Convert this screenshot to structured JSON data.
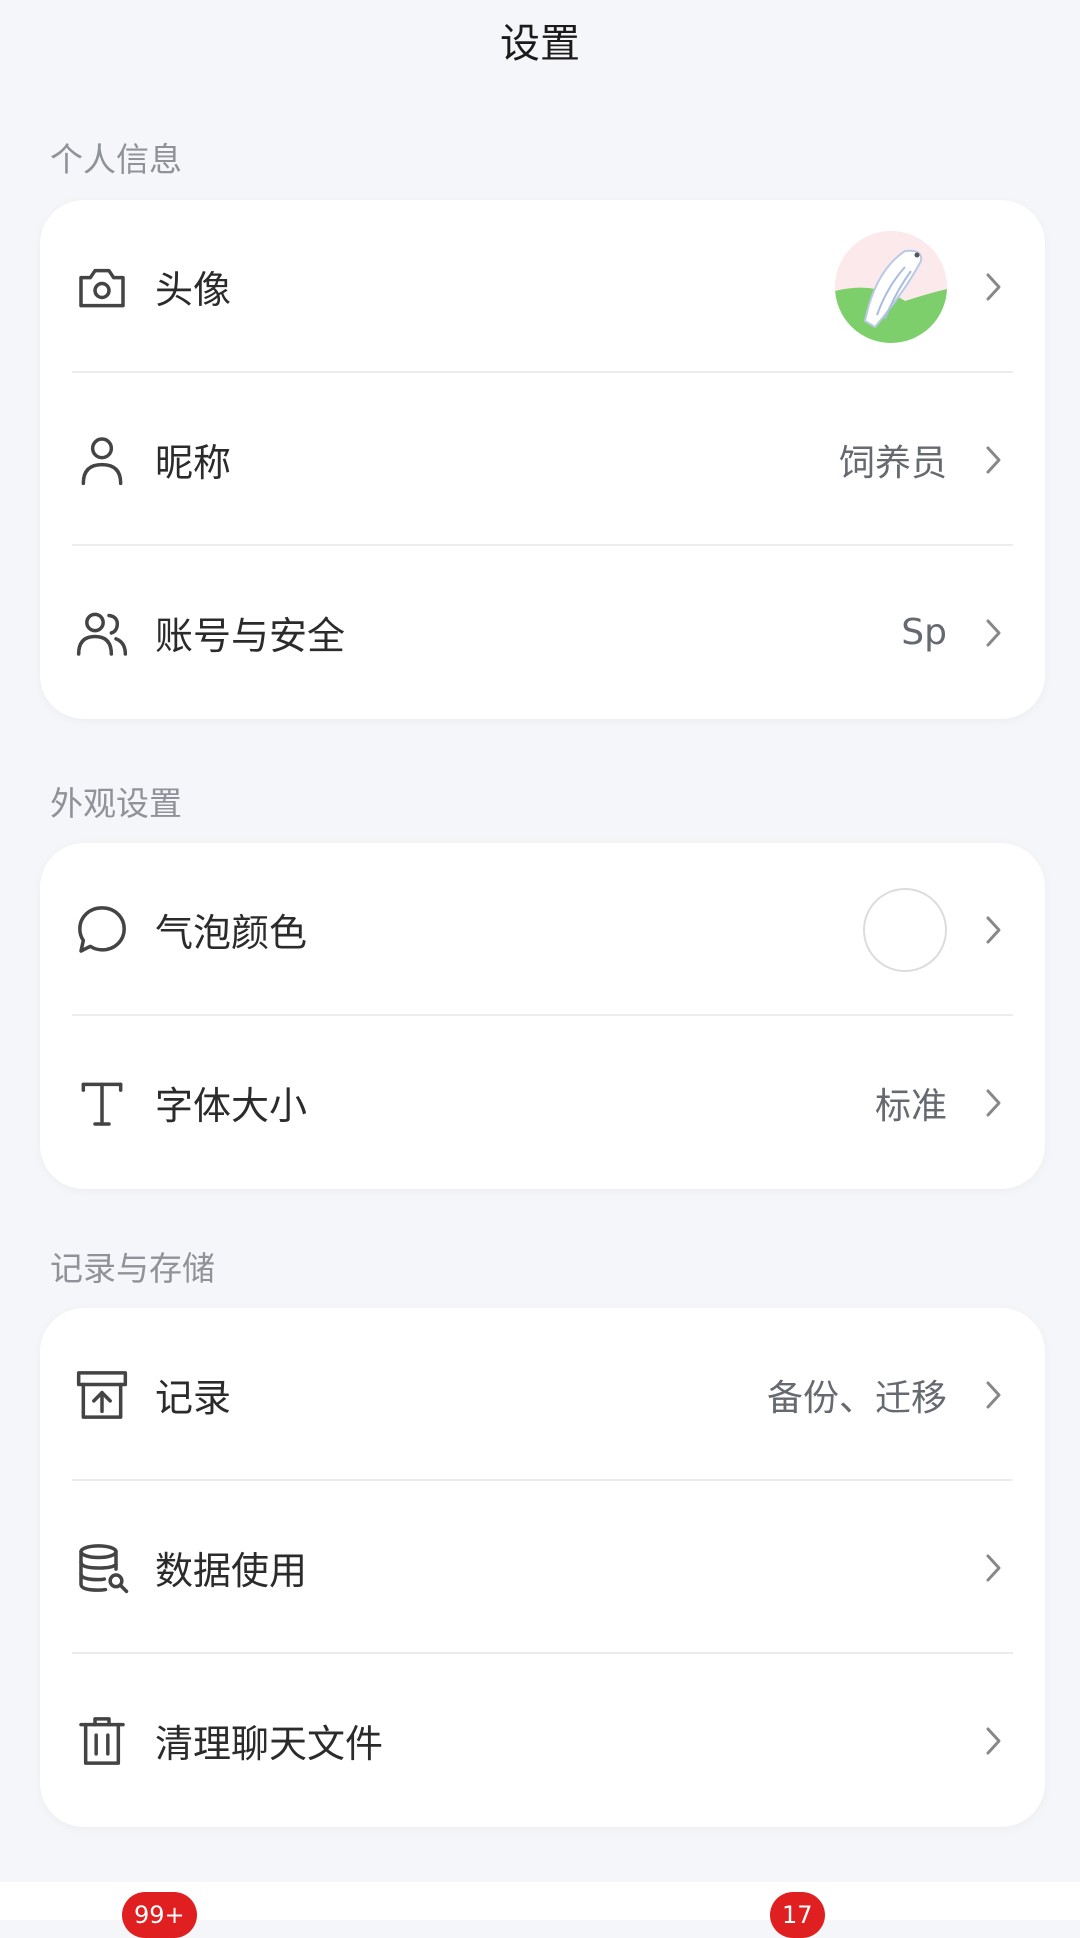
{
  "header": {
    "title": "设置"
  },
  "sections": [
    {
      "label": "个人信息",
      "items": [
        {
          "icon": "camera-icon",
          "label": "头像",
          "value": "",
          "trailing": "avatar"
        },
        {
          "icon": "user-icon",
          "label": "昵称",
          "value": "饲养员"
        },
        {
          "icon": "users-icon",
          "label": "账号与安全",
          "value": "Sp"
        }
      ]
    },
    {
      "label": "外观设置",
      "items": [
        {
          "icon": "chat-bubble-icon",
          "label": "气泡颜色",
          "value": "",
          "trailing": "color-swatch",
          "swatch_color": "#ffffff"
        },
        {
          "icon": "text-t-icon",
          "label": "字体大小",
          "value": "标准"
        }
      ]
    },
    {
      "label": "记录与存储",
      "items": [
        {
          "icon": "archive-upload-icon",
          "label": "记录",
          "value": "备份、迁移"
        },
        {
          "icon": "database-search-icon",
          "label": "数据使用",
          "value": ""
        },
        {
          "icon": "trash-icon",
          "label": "清理聊天文件",
          "value": ""
        }
      ]
    }
  ],
  "bottom_bar": {
    "badges": [
      "99+",
      "17"
    ],
    "badge_color": "#e02020"
  }
}
